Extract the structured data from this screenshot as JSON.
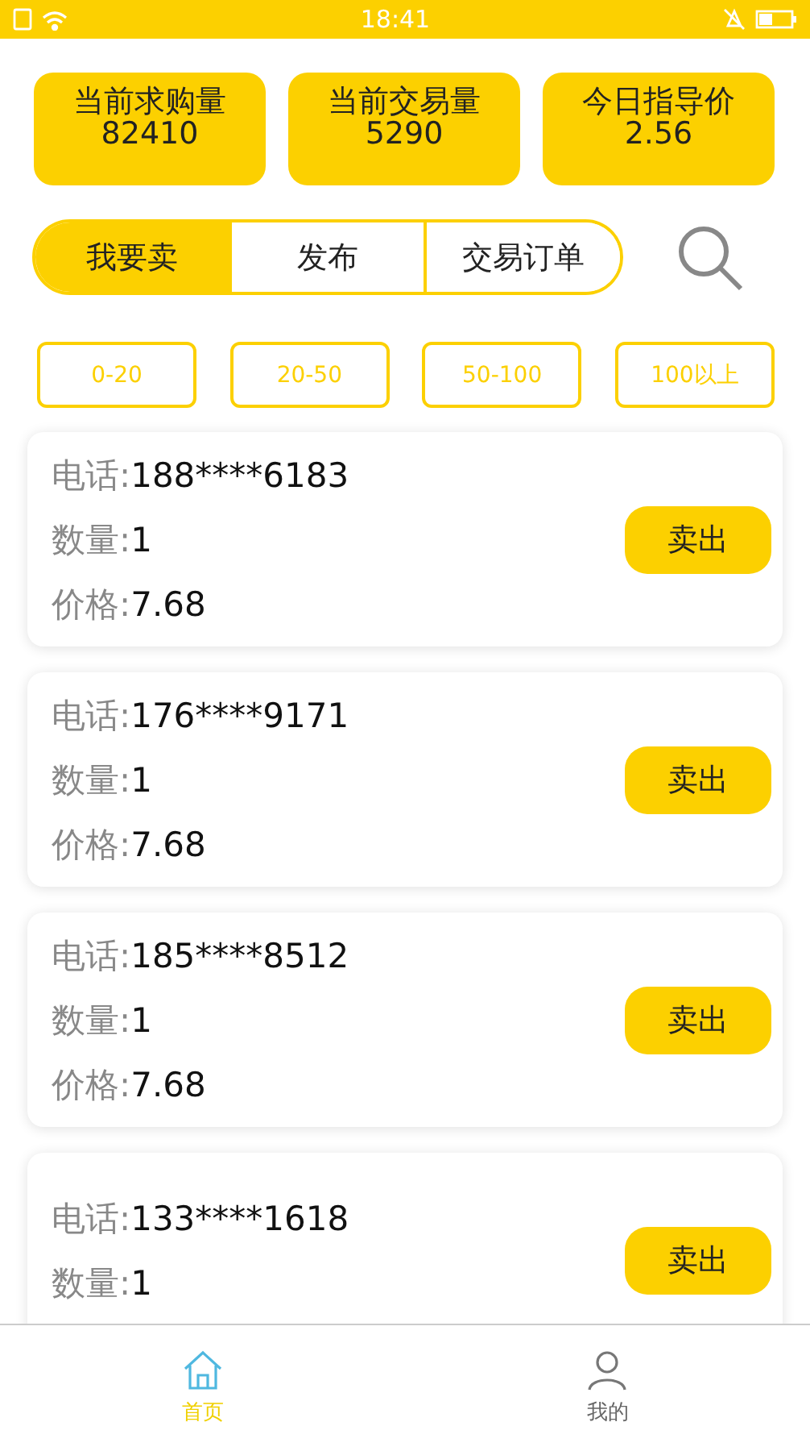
{
  "status_bar": {
    "time": "18:41"
  },
  "stats": [
    {
      "label": "当前求购量",
      "value": "82410"
    },
    {
      "label": "当前交易量",
      "value": "5290"
    },
    {
      "label": "今日指导价",
      "value": "2.56"
    }
  ],
  "tabs": [
    {
      "label": "我要卖",
      "selected": true
    },
    {
      "label": "发布",
      "selected": false
    },
    {
      "label": "交易订单",
      "selected": false
    }
  ],
  "filters": [
    "0-20",
    "20-50",
    "50-100",
    "100以上"
  ],
  "orders": [
    {
      "phone_label": "电话:",
      "phone": "188****6183",
      "qty_label": "数量:",
      "qty": "1",
      "price_label": "价格:",
      "price": "7.68",
      "action": "卖出"
    },
    {
      "phone_label": "电话:",
      "phone": "176****9171",
      "qty_label": "数量:",
      "qty": "1",
      "price_label": "价格:",
      "price": "7.68",
      "action": "卖出"
    },
    {
      "phone_label": "电话:",
      "phone": "185****8512",
      "qty_label": "数量:",
      "qty": "1",
      "price_label": "价格:",
      "price": "7.68",
      "action": "卖出"
    },
    {
      "phone_label": "电话:",
      "phone": "133****1618",
      "qty_label": "数量:",
      "qty": "1",
      "action": "卖出"
    }
  ],
  "bottom_nav": [
    {
      "label": "首页",
      "kind": "home",
      "selected": true
    },
    {
      "label": "我的",
      "kind": "profile",
      "selected": false
    }
  ]
}
